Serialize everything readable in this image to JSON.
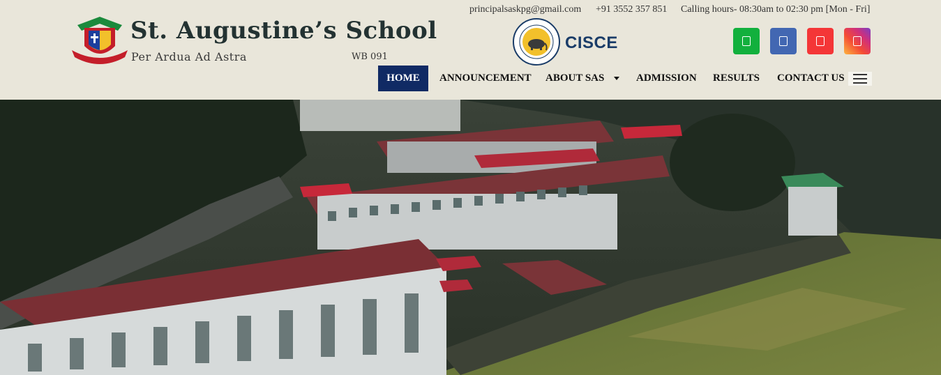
{
  "brand": {
    "title": "St. Augustine’s School",
    "motto": "Per Ardua Ad Astra",
    "code": "WB 091"
  },
  "contact": {
    "email": "principalsaskpg@gmail.com",
    "phone": "+91 3552 357 851",
    "hours": "Calling hours- 08:30am to 02:30 pm [Mon - Fri]"
  },
  "affiliation": {
    "label": "CISCE"
  },
  "social": [
    {
      "name": "phone-icon",
      "color": "#12b03d"
    },
    {
      "name": "facebook-icon",
      "color": "#4267b2"
    },
    {
      "name": "youtube-icon",
      "color": "#f43637"
    },
    {
      "name": "instagram-icon",
      "color": "#d0307a"
    }
  ],
  "nav": {
    "home": "HOME",
    "announcement": "ANNOUNCEMENT",
    "about": "ABOUT SAS",
    "admission": "ADMISSION",
    "results": "RESULTS",
    "contact": "CONTACT US",
    "active": "HOME",
    "active_color": "#102a64"
  },
  "menu_icon": "hamburger-icon",
  "hero": {
    "image": "campus-aerial-photo"
  }
}
